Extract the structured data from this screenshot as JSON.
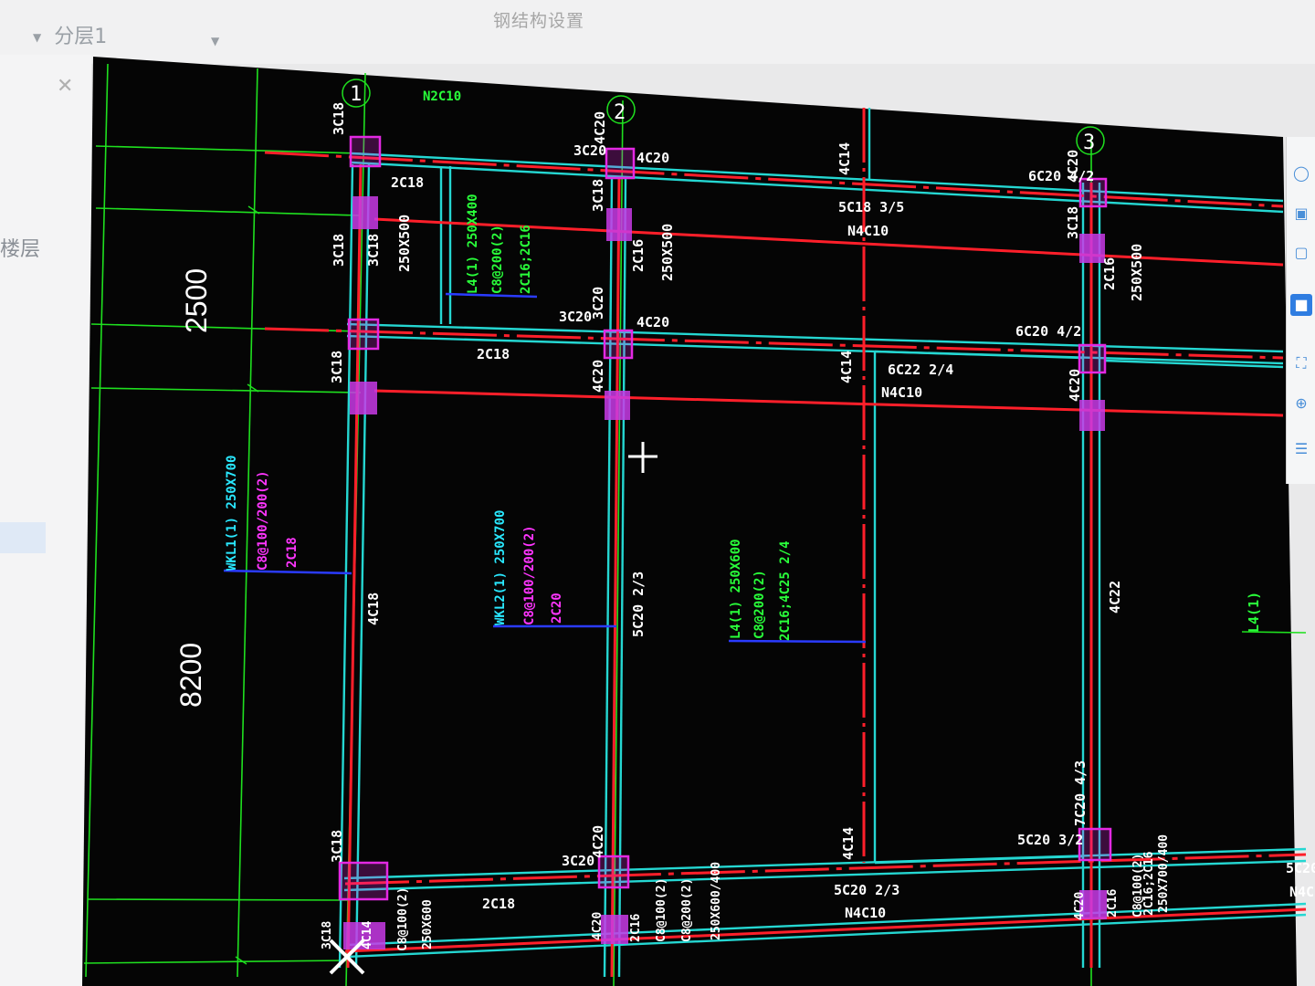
{
  "app": {
    "window_title": "钢结构设置",
    "floor_selector": "分层1",
    "left_panel_label": "楼层"
  },
  "icons": {
    "close": "close-icon",
    "caret": "caret-down-icon",
    "cursor": "crosshair-cursor-icon",
    "tools": [
      "sphere-view-icon",
      "3d-view-icon",
      "box-view-icon",
      "cube-solid-icon",
      "fullscreen-icon",
      "orbit-icon",
      "layer-list-icon"
    ]
  },
  "colors": {
    "background": "#050505",
    "axis": "#1fe01f",
    "beam_edge": "#25d7d2",
    "rebar": "#ff1f2a",
    "column": "#e329e3",
    "leader": "#2a3bff",
    "text_white": "#ffffff",
    "text_green": "#29ff3a",
    "text_cyan": "#29e8ff",
    "text_magenta": "#ff35ff"
  },
  "drawing": {
    "axes": [
      "1",
      "2",
      "3"
    ],
    "dimensions": [
      "2500",
      "8200"
    ],
    "labels": {
      "n2c10": "N2C10",
      "c3c18_top": "3C18",
      "c4c20_a2": "4C20",
      "c4c14_top": "4C14",
      "c4c20_a3": "4C20",
      "t3c20_1": "3C20",
      "t4c20_1": "4C20",
      "t2c18_1": "2C18",
      "t6c20_1": "6C20 4/2",
      "t3c18_l1": "3C18",
      "t3c18_l2": "3C18",
      "t3c18_mid1": "3C18",
      "t2c16_mid": "2C16",
      "t250x500_1": "250X500",
      "t250x500_2": "250X500",
      "t2c16_r": "2C16",
      "t250x500_r": "250X500",
      "t3c18_r": "3C18",
      "t5c18": "5C18 3/5",
      "tn4c10_1": "N4C10",
      "t3c20_2": "3C20",
      "t4c20_2": "4C20",
      "t3c20_3": "3C20",
      "t2c18_2": "2C18",
      "t3c18_l3": "3C18",
      "t4c20_v": "4C20",
      "t4c14_v": "4C14",
      "t6c20_2": "6C20 4/2",
      "t4c20_vr": "4C20",
      "t6c22": "6C22 2/4",
      "tn4c10_2": "N4C10",
      "sb1_1": "WKL1(1) 250X700",
      "sb1_2": "C8@100/200(2)",
      "sb1_3": "2C18",
      "sb2_1": "WKL2(1) 250X700",
      "sb2_2": "C8@100/200(2)",
      "sb2_3": "2C20",
      "sb3_1": "L4(1) 250X600",
      "sb3_2": "C8@200(2)",
      "sb3_3": "2C16;4C25 2/4",
      "sb_top_1": "L4(1) 250X400",
      "sb_top_2": "C8@200(2)",
      "sb_top_3": "2C16;2C16",
      "t4c18_v": "4C18",
      "t5c20_23": "5C20 2/3",
      "t4c22_v": "4C22",
      "l4_far": "L4(1)",
      "t3c18_bl": "3C18",
      "t3c20_b": "3C20",
      "t4c20_bv": "4C20",
      "t4c14_bv": "4C14",
      "t5c20_32": "5C20 3/2",
      "t7c20": "7C20 4/3",
      "t2c18_b": "2C18",
      "t5c20_b": "5C20 2/3",
      "tn4c10_b": "N4C10",
      "t5c20_far": "5C20",
      "tn4_far": "N4C",
      "bv1": "3C18",
      "bv2": "4C14",
      "bv3": "C8@100(2)",
      "bv4": "250X600",
      "bv5": "4C20",
      "bv6": "2C16",
      "bv7": "C8@100(2)",
      "bv8": "C8@200(2)",
      "bv9": "250X600/400",
      "bv10": "4C20",
      "bv11": "2C16",
      "bv12": "C8@100(2)",
      "bv13": "2C16;2C16",
      "bv14": "250X700/400"
    }
  }
}
